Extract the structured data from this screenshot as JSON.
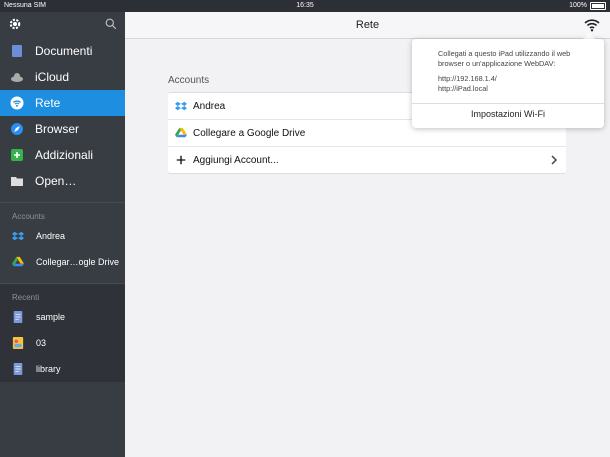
{
  "status_bar": {
    "carrier": "Nessuna SIM",
    "time": "16:35",
    "battery": "100%"
  },
  "sidebar": {
    "nav": [
      {
        "label": "Documenti",
        "icon": "document-icon"
      },
      {
        "label": "iCloud",
        "icon": "cloud-icon"
      },
      {
        "label": "Rete",
        "icon": "wifi-icon",
        "active": true
      },
      {
        "label": "Browser",
        "icon": "compass-icon"
      },
      {
        "label": "Addizionali",
        "icon": "plus-icon"
      },
      {
        "label": "Open…",
        "icon": "folder-icon"
      }
    ],
    "accounts_header": "Accounts",
    "accounts": [
      {
        "label": "Andrea",
        "icon": "dropbox-icon"
      },
      {
        "label": "Collegar…ogle Drive",
        "icon": "google-drive-icon"
      }
    ],
    "recents_header": "Recenti",
    "recents": [
      {
        "label": "sample",
        "icon": "file-icon"
      },
      {
        "label": "03",
        "icon": "image-file-icon"
      },
      {
        "label": "library",
        "icon": "file-icon"
      }
    ]
  },
  "header": {
    "title": "Rete"
  },
  "main": {
    "accounts_label": "Accounts",
    "rows": [
      {
        "label": "Andrea",
        "icon": "dropbox-icon"
      },
      {
        "label": "Collegare a Google Drive",
        "icon": "google-drive-icon"
      },
      {
        "label": "Aggiungi Account...",
        "icon": "plus-icon"
      }
    ]
  },
  "popover": {
    "text": "Collegati a questo iPad utilizzando il web browser o un'applicazione WebDAV:",
    "url1": "http://192.168.1.4/",
    "url2": "http://iPad.local",
    "button": "Impostazioni Wi-Fi"
  },
  "colors": {
    "accent": "#1e8fe0",
    "sidebar_bg": "#383c43"
  }
}
